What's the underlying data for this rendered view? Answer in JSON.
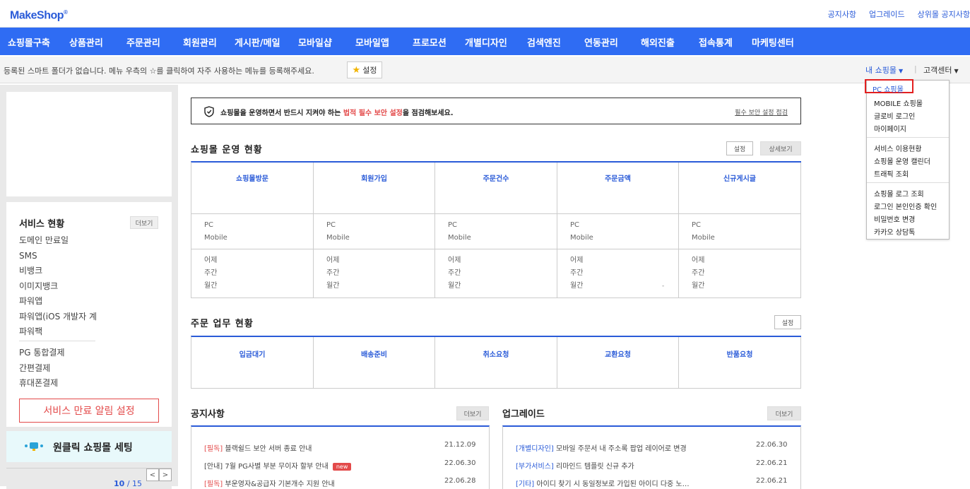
{
  "top": {
    "logo": "MakeShop",
    "links": [
      "공지사항",
      "업그레이드",
      "상위몰 공지사항"
    ]
  },
  "nav": [
    "쇼핑몰구축",
    "상품관리",
    "주문관리",
    "회원관리",
    "게시판/메일",
    "모바일샵",
    "모바일앱",
    "프로모션",
    "개별디자인",
    "검색엔진",
    "연동관리",
    "해외진출",
    "접속통계",
    "마케팅센터"
  ],
  "favbar": {
    "message": "등록된 스마트 폴더가 없습니다. 메뉴 우측의 ☆를 클릭하여 자주 사용하는 메뉴를 등록해주세요.",
    "setting_label": "설정",
    "myshop": "내 쇼핑몰",
    "customer_center": "고객센터"
  },
  "dropdown": {
    "active": "PC 쇼핑몰",
    "group1": [
      "MOBILE 쇼핑몰",
      "글로비 로그인",
      "마이페이지"
    ],
    "group2": [
      "서비스 이용현황",
      "쇼핑몰 운영 캘린더",
      "트래픽 조회"
    ],
    "group3": [
      "쇼핑몰 로그 조회",
      "로그인 본인인증 확인",
      "비밀번호 변경",
      "카카오 상담톡"
    ]
  },
  "sidebar": {
    "service_title": "서비스 현황",
    "more": "더보기",
    "services1": [
      "도메인 만료일",
      "SMS",
      "비뱅크",
      "이미지뱅크",
      "파워앱",
      "파워앱(iOS 개발자 계정)",
      "파워팩"
    ],
    "services2": [
      "PG 통합결제",
      "간편결제",
      "휴대폰결제"
    ],
    "alarm_button": "서비스 만료 알림 설정",
    "oneclick": "원클릭 쇼핑몰 세팅",
    "page_current": "10",
    "page_total": "/ 15"
  },
  "notice": {
    "prefix": "쇼핑몰을 운영하면서 반드시 지켜야 하는 ",
    "highlight": "법적 필수 보안 설정",
    "suffix": "을 점검해보세요.",
    "link": "필수 보안 설정 점검"
  },
  "operation": {
    "title": "쇼핑몰 운영 현황",
    "setting": "설정",
    "detail": "상세보기",
    "columns": [
      "쇼핑몰방문",
      "회원가입",
      "주문건수",
      "주문금액",
      "신규게시글"
    ],
    "row1": [
      "PC",
      "Mobile"
    ],
    "row2": [
      "어제",
      "주간",
      "월간"
    ],
    "dash": "-"
  },
  "orders": {
    "title": "주문 업무 현황",
    "setting": "설정",
    "columns": [
      "입금대기",
      "배송준비",
      "취소요청",
      "교환요청",
      "반품요청"
    ]
  },
  "notices": {
    "title": "공지사항",
    "more": "더보기",
    "items": [
      {
        "tag": "[필독]",
        "text": " 블랙쉴드 보안 서버 종료 안내",
        "date": "21.12.09",
        "new": ""
      },
      {
        "tag": "[안내]",
        "text": " 7월 PG사별 부분 무이자 할부 안내",
        "date": "22.06.30",
        "new": "new"
      },
      {
        "tag": "[필독]",
        "text": " 부운영자&공급자 기본개수 지원 안내",
        "date": "22.06.28",
        "new": ""
      }
    ]
  },
  "upgrades": {
    "title": "업그레이드",
    "more": "더보기",
    "items": [
      {
        "tag": "[개별디자인]",
        "text": " 모바일 주문서 내 주소록 팝업 레이어로 변경",
        "date": "22.06.30"
      },
      {
        "tag": "[부가서비스]",
        "text": " 리마인드 템플릿 신규 추가",
        "date": "22.06.21"
      },
      {
        "tag": "[기타]",
        "text": " 아이디 찾기 시 동일정보로 가입된 아이디 다중 노…",
        "date": "22.06.21"
      }
    ]
  }
}
